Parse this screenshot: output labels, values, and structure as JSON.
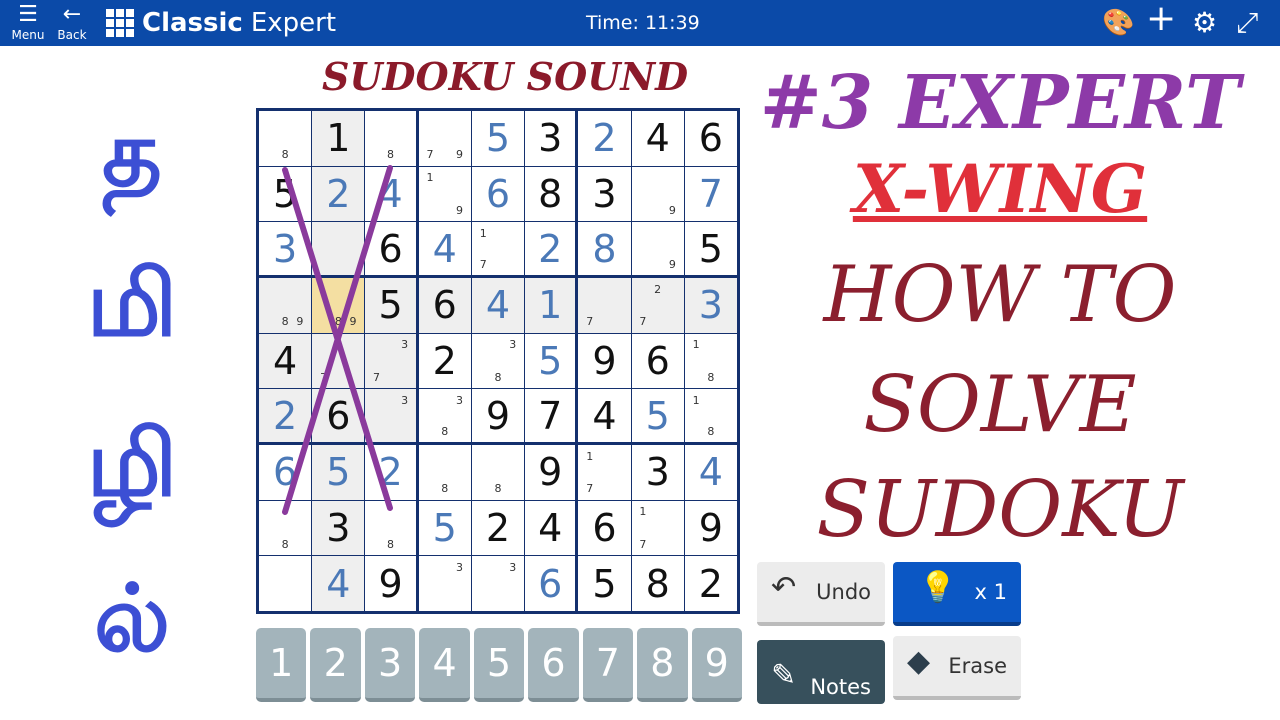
{
  "header": {
    "menu_label": "Menu",
    "back_label": "Back",
    "title_bold": "Classic",
    "title_rest": "Expert",
    "time": "Time: 11:39",
    "icons": [
      "menu-icon",
      "back-arrow-icon",
      "grid-icon",
      "palette-icon",
      "plus-icon",
      "gear-icon",
      "fullscreen-icon"
    ]
  },
  "overlay": {
    "top": "SUDOKU SOUND",
    "line1": "#3 EXPERT",
    "line2": "X-WING",
    "line3": "HOW TO",
    "line4": "SOLVE",
    "line5": "SUDOKU",
    "tamil": [
      "த",
      "மி",
      "ழி",
      "ல்"
    ],
    "colors": {
      "top": "#8b1a2a",
      "line1": "#8d3aa8",
      "line2": "#e0303a",
      "rest": "#8b1f2e",
      "tamil": "#3c4fd4",
      "xmark": "#8a3a9c"
    }
  },
  "board": {
    "legend": "g = given, u = user-entered, n = pencil notes",
    "rows": [
      [
        "n8",
        "1g",
        "n8",
        "n79",
        "5u",
        "3g",
        "2u",
        "4g",
        "6g"
      ],
      [
        "5g",
        "2u",
        "4u",
        "n19",
        "6u",
        "8g",
        "3g",
        "n9",
        "7u"
      ],
      [
        "3u",
        "",
        "6g",
        "4u",
        "n17",
        "2u",
        "8u",
        "n9",
        "5g"
      ],
      [
        "n89",
        "n89",
        "5g",
        "6g",
        "4u",
        "1u",
        "n7",
        "n27",
        "3u"
      ],
      [
        "4g",
        "n7",
        "n37",
        "2g",
        "n38",
        "5u",
        "9g",
        "6g",
        "n18"
      ],
      [
        "2u",
        "6g",
        "n3",
        "n38",
        "9g",
        "7g",
        "4g",
        "5u",
        "n18"
      ],
      [
        "6u",
        "5u",
        "2u",
        "n8",
        "n8",
        "9g",
        "n17",
        "3g",
        "4u"
      ],
      [
        "n8",
        "3g",
        "n8",
        "5u",
        "2g",
        "4g",
        "6g",
        "n17",
        "9g"
      ],
      [
        "",
        "4u",
        "9g",
        "n3",
        "n3",
        "6u",
        "5g",
        "8g",
        "2g"
      ]
    ],
    "selected": [
      4,
      2
    ]
  },
  "pad": [
    "1",
    "2",
    "3",
    "4",
    "5",
    "6",
    "7",
    "8",
    "9"
  ],
  "actions": {
    "undo": "Undo",
    "hint": "x 1",
    "notes": "Notes",
    "erase": "Erase"
  }
}
